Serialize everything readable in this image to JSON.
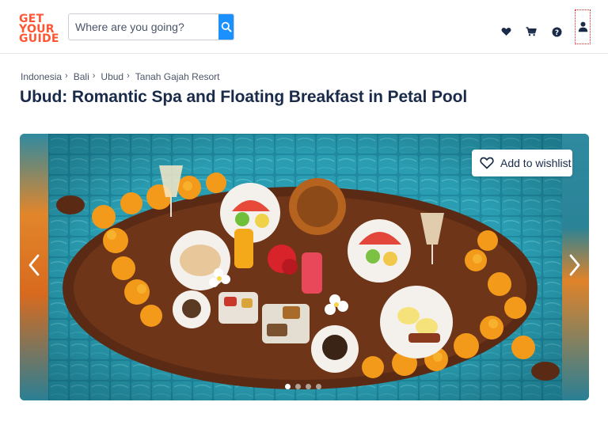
{
  "header": {
    "logo_lines": [
      "GET",
      "YOUR",
      "GUIDE"
    ],
    "search_placeholder": "Where are you going?",
    "icons": [
      "heart-icon",
      "cart-icon",
      "help-icon",
      "profile-icon"
    ]
  },
  "breadcrumb": [
    "Indonesia",
    "Bali",
    "Ubud",
    "Tanah Gajah Resort"
  ],
  "title": "Ubud: Romantic Spa and Floating Breakfast in Petal Pool",
  "gallery": {
    "wishlist_label": "Add to wishlist",
    "slide_count": 4,
    "active_slide": 1
  },
  "colors": {
    "brand": "#ff5533",
    "accent_blue": "#1a91ff",
    "text_dark": "#1a2b49"
  }
}
